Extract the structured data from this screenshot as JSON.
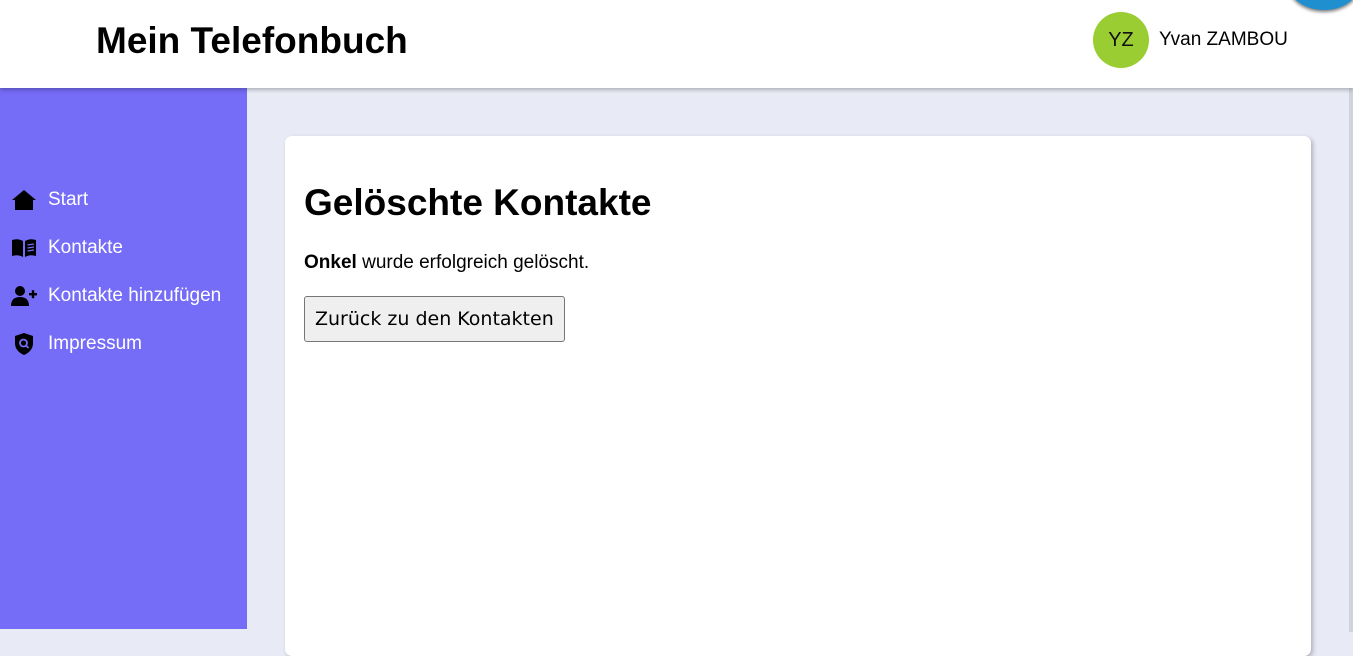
{
  "header": {
    "title": "Mein Telefonbuch",
    "user": {
      "initials": "YZ",
      "name": "Yvan ZAMBOU",
      "avatar_color": "#9acd32"
    }
  },
  "sidebar": {
    "background": "#756cf7",
    "items": [
      {
        "label": "Start",
        "icon": "home-icon"
      },
      {
        "label": "Kontakte",
        "icon": "address-book-icon"
      },
      {
        "label": "Kontakte hinzufügen",
        "icon": "user-plus-icon"
      },
      {
        "label": "Impressum",
        "icon": "shield-search-icon"
      }
    ]
  },
  "main": {
    "title": "Gelöschte Kontakte",
    "message": {
      "contact_name": "Onkel",
      "text": " wurde erfolgreich gelöscht."
    },
    "back_button_label": "Zurück zu den Kontakten"
  }
}
